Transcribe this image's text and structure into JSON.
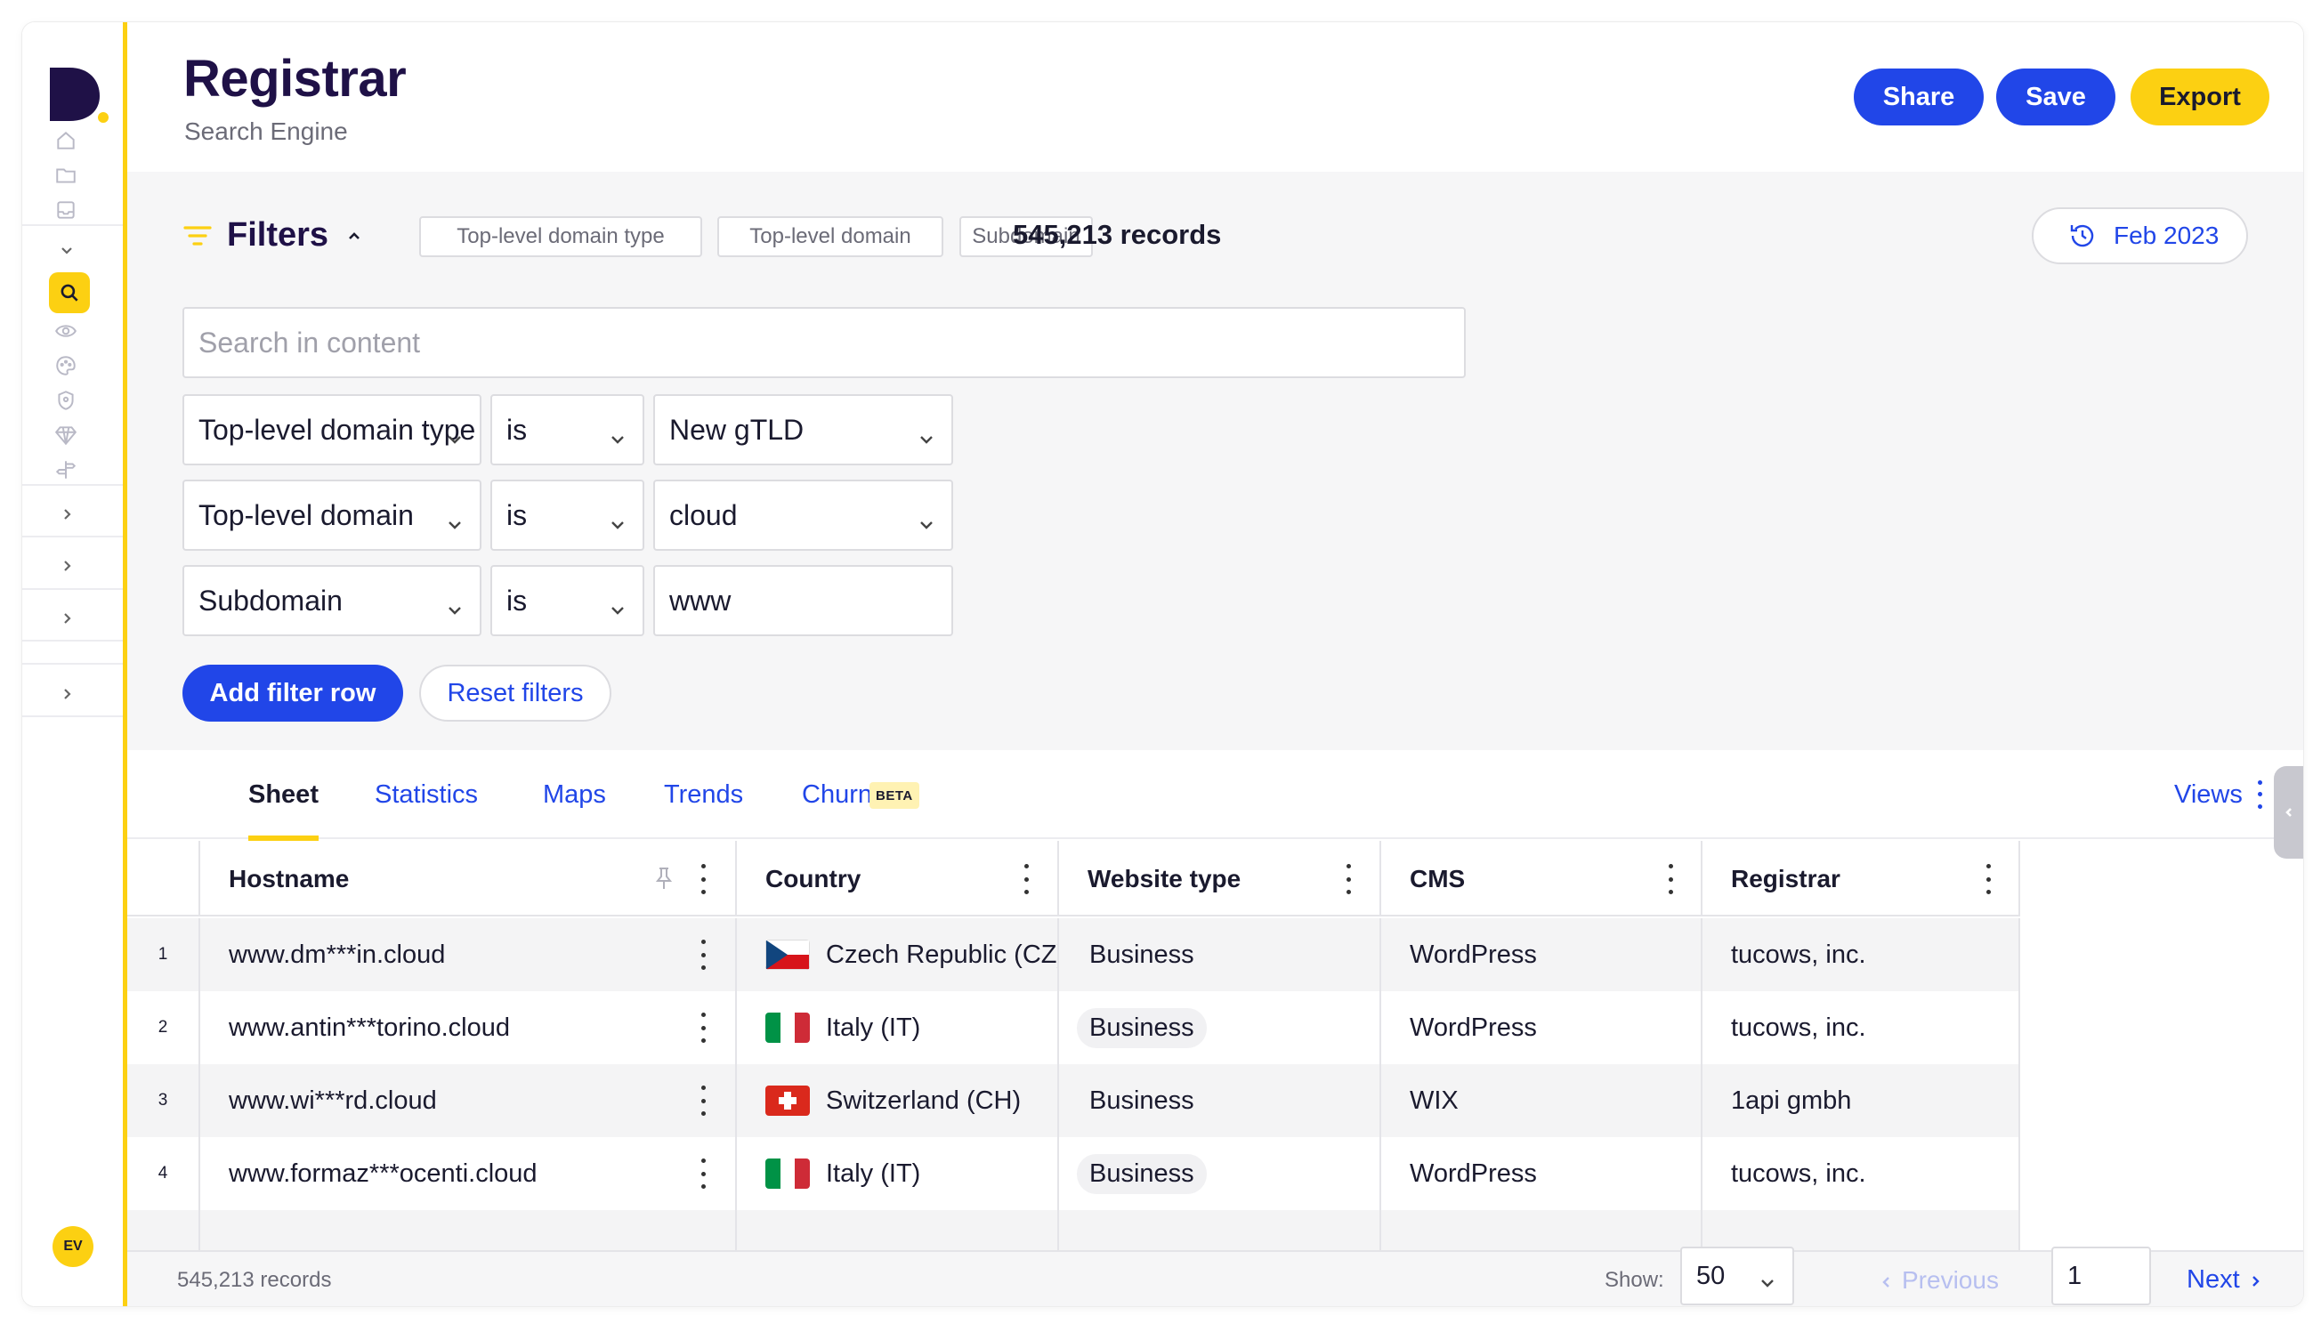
{
  "app": {
    "title": "Registrar",
    "subtitle": "Search Engine",
    "user_initials": "EV",
    "accent": "#fcd012",
    "primary": "#2146e8",
    "brand_dark": "#1f1147"
  },
  "header": {
    "share_label": "Share",
    "save_label": "Save",
    "export_label": "Export"
  },
  "sidebar": {
    "icons": [
      "home-icon",
      "folder-icon",
      "inbox-icon",
      "chevron-down-icon",
      "search-icon",
      "eye-icon",
      "palette-icon",
      "shield-icon",
      "diamond-icon",
      "signpost-icon"
    ],
    "active": "search-icon"
  },
  "filters": {
    "title": "Filters",
    "chips": [
      "Top-level domain type",
      "Top-level domain",
      "Subdomain"
    ],
    "records": "545,213 records",
    "date_label": "Feb 2023",
    "search_placeholder": "Search in content",
    "rows": [
      {
        "field": "Top-level domain type",
        "operator": "is",
        "value": "New gTLD"
      },
      {
        "field": "Top-level domain",
        "operator": "is",
        "value": "cloud"
      },
      {
        "field": "Subdomain",
        "operator": "is",
        "value": "www"
      }
    ],
    "add_label": "Add filter row",
    "reset_label": "Reset filters"
  },
  "tabs": {
    "items": [
      "Sheet",
      "Statistics",
      "Maps",
      "Trends",
      "Churn"
    ],
    "active": "Sheet",
    "beta": "BETA",
    "views_label": "Views"
  },
  "table": {
    "columns": [
      "Hostname",
      "Country",
      "Website type",
      "CMS",
      "Registrar"
    ],
    "rows": [
      {
        "n": "1",
        "hostname": "www.dm***in.cloud",
        "country": "Czech Republic (CZ)",
        "flag": "cz",
        "type": "Business",
        "cms": "WordPress",
        "registrar": "tucows, inc."
      },
      {
        "n": "2",
        "hostname": "www.antin***torino.cloud",
        "country": "Italy (IT)",
        "flag": "it",
        "type": "Business",
        "cms": "WordPress",
        "registrar": "tucows, inc."
      },
      {
        "n": "3",
        "hostname": "www.wi***rd.cloud",
        "country": "Switzerland (CH)",
        "flag": "ch",
        "type": "Business",
        "cms": "WIX",
        "registrar": "1api gmbh"
      },
      {
        "n": "4",
        "hostname": "www.formaz***ocenti.cloud",
        "country": "Italy (IT)",
        "flag": "it",
        "type": "Business",
        "cms": "WordPress",
        "registrar": "tucows, inc."
      }
    ]
  },
  "footer": {
    "records": "545,213 records",
    "show_label": "Show:",
    "page_size": "50",
    "prev_label": "Previous",
    "page": "1",
    "next_label": "Next"
  }
}
